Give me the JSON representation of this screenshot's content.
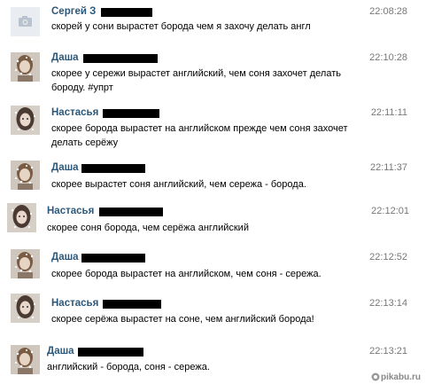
{
  "messages": [
    {
      "name": "Сергей З",
      "time": "22:08:28",
      "lines": [
        "скорей у сони вырастет борода чем я захочу делать англ"
      ],
      "avatar": "camera-placeholder-icon"
    },
    {
      "name": "Даша",
      "time": "22:10:28",
      "lines": [
        "скорее у сережи вырастет английский, чем соня захочет делать",
        "бороду. #упрт"
      ],
      "avatar": "girl-photo"
    },
    {
      "name": "Настасья",
      "time": "22:11:11",
      "lines": [
        "скорее борода вырастет на английском прежде чем соня захочет",
        "делать серёжу"
      ],
      "avatar": "girl-photo-2"
    },
    {
      "name": "Даша",
      "time": "22:11:37",
      "lines": [
        "скорее вырастет соня английский, чем сережа - борода."
      ],
      "avatar": "girl-photo"
    },
    {
      "name": "Настасья",
      "time": "22:12:01",
      "lines": [
        "скорее соня борода, чем серёжа английский"
      ],
      "avatar": "girl-photo-2"
    },
    {
      "name": "Даша",
      "time": "22:12:52",
      "lines": [
        "скорее борода вырастет на английском, чем соня - сережа."
      ],
      "avatar": "girl-photo"
    },
    {
      "name": "Настасья",
      "time": "22:13:14",
      "lines": [
        "скорее серёжа вырастет на соне, чем английский борода!"
      ],
      "avatar": "girl-photo-2"
    },
    {
      "name": "Даша",
      "time": "22:13:21",
      "lines": [
        "английский - борода, соня - сережа."
      ],
      "avatar": "girl-photo"
    }
  ],
  "watermark": "pikabu.ru",
  "colors": {
    "name": "#2b587a",
    "time": "#777777",
    "redaction": "#000000"
  }
}
